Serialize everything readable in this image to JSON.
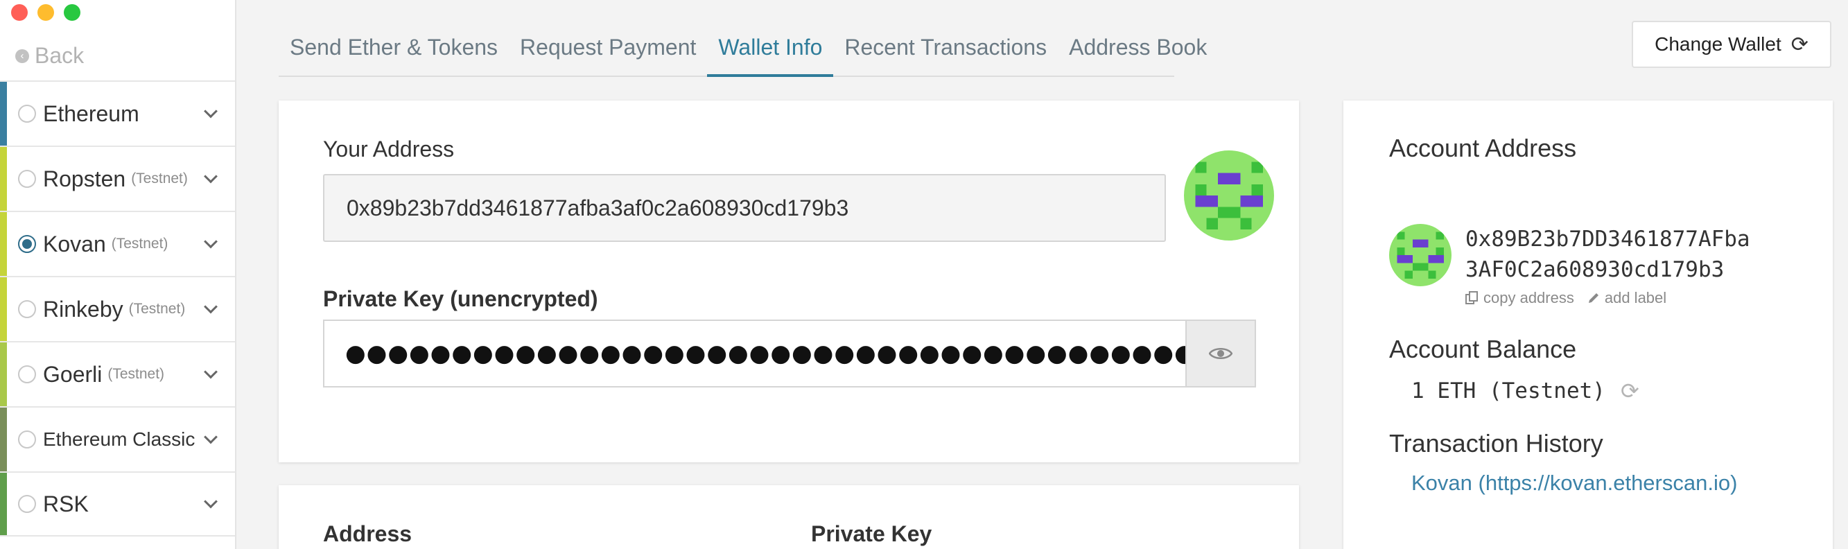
{
  "window": {
    "controls": {
      "close_color": "#ff5f57",
      "minimize_color": "#febc2e",
      "zoom_color": "#28c840"
    }
  },
  "sidebar": {
    "back_label": "Back",
    "networks": [
      {
        "name": "Ethereum",
        "sub": "",
        "selected": false,
        "bar_color": "#3a7fa0"
      },
      {
        "name": "Ropsten",
        "sub": "(Testnet)",
        "selected": false,
        "bar_color": "#c5d43a"
      },
      {
        "name": "Kovan",
        "sub": "(Testnet)",
        "selected": true,
        "bar_color": "#c5d43a"
      },
      {
        "name": "Rinkeby",
        "sub": "(Testnet)",
        "selected": false,
        "bar_color": "#c5d43a"
      },
      {
        "name": "Goerli",
        "sub": "(Testnet)",
        "selected": false,
        "bar_color": "#a9c84a"
      },
      {
        "name": "Ethereum Classic",
        "sub": "",
        "selected": false,
        "bar_color": "#7a8f5a"
      },
      {
        "name": "RSK",
        "sub": "",
        "selected": false,
        "bar_color": "#5f9e4b"
      }
    ]
  },
  "tabs": [
    {
      "label": "Send Ether & Tokens",
      "active": false
    },
    {
      "label": "Request Payment",
      "active": false
    },
    {
      "label": "Wallet Info",
      "active": true
    },
    {
      "label": "Recent Transactions",
      "active": false
    },
    {
      "label": "Address Book",
      "active": false
    }
  ],
  "change_wallet": {
    "label": "Change Wallet",
    "icon": "refresh-icon"
  },
  "wallet_info": {
    "your_address_label": "Your Address",
    "address_value": "0x89b23b7dd3461877afba3af0c2a608930cd179b3",
    "private_key_label": "Private Key (unencrypted)",
    "private_key_masked": "●●●●●●●●●●●●●●●●●●●●●●●●●●●●●●●●●●●●●●●●●●●●●●●●●●●●●●●●●●●●●●●●",
    "bottom_address_label": "Address",
    "bottom_private_key_label": "Private Key"
  },
  "account": {
    "address_heading": "Account Address",
    "address_line1": "0x89B23b7DD3461877AFba",
    "address_line2": "3AF0C2a608930cd179b3",
    "copy_label": "copy address",
    "add_label": "add label",
    "balance_heading": "Account Balance",
    "balance_value": "1 ETH (Testnet)",
    "history_heading": "Transaction History",
    "history_link": "Kovan (https://kovan.etherscan.io)"
  },
  "colors": {
    "accent": "#2f7c9a",
    "identicon_bg": "#8fe36b",
    "identicon_purple": "#6a3fd0",
    "identicon_green": "#3cbf3c"
  }
}
